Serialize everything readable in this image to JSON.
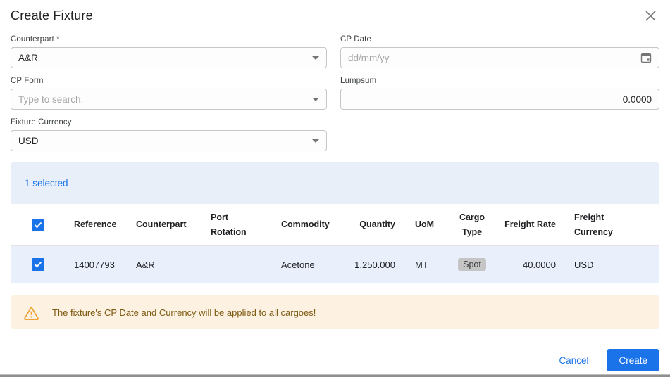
{
  "dialog": {
    "title": "Create Fixture"
  },
  "form": {
    "counterpart": {
      "label": "Counterpart *",
      "value": "A&R"
    },
    "cp_date": {
      "label": "CP Date",
      "placeholder": "dd/mm/yy"
    },
    "cp_form": {
      "label": "CP Form",
      "placeholder": "Type to search."
    },
    "lumpsum": {
      "label": "Lumpsum",
      "value": "0.0000"
    },
    "fixture_currency": {
      "label": "Fixture Currency",
      "value": "USD"
    }
  },
  "table": {
    "selected_count": "1 selected",
    "columns": {
      "reference": "Reference",
      "counterpart": "Counterpart",
      "port_rotation": "Port Rotation",
      "commodity": "Commodity",
      "quantity": "Quantity",
      "uom": "UoM",
      "cargo_type": "Cargo Type",
      "freight_rate": "Freight Rate",
      "freight_currency": "Freight Currency"
    },
    "rows": [
      {
        "selected": true,
        "reference": "14007793",
        "counterpart": "A&R",
        "port_rotation": "",
        "commodity": "Acetone",
        "quantity": "1,250.000",
        "uom": "MT",
        "cargo_type": "Spot",
        "freight_rate": "40.0000",
        "freight_currency": "USD"
      }
    ]
  },
  "warning": {
    "message": "The fixture's CP Date and Currency will be applied to all cargoes!"
  },
  "footer": {
    "cancel_label": "Cancel",
    "create_label": "Create"
  },
  "colors": {
    "accent": "#1a73e8",
    "selected_banner_bg": "#e8eff9",
    "selected_row_bg": "#eaf0fb",
    "warning_bg": "#fdf1e2",
    "warning_text": "#7d5a11",
    "warning_icon": "#f0a437",
    "badge_bg": "#c5c5c5"
  }
}
